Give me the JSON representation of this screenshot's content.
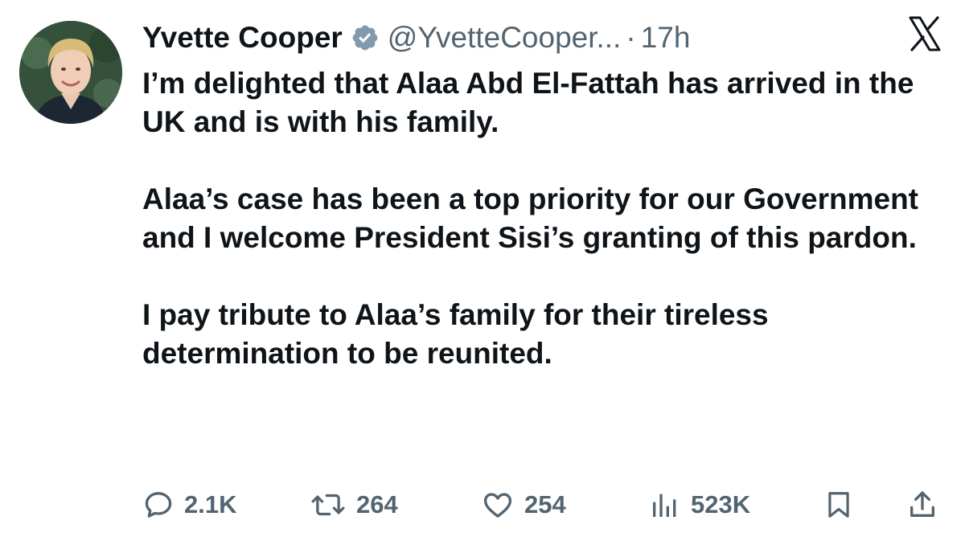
{
  "author": {
    "display_name": "Yvette Cooper",
    "handle": "@YvetteCooper...",
    "separator": "·",
    "timestamp": "17h",
    "verified_color": "#829aab"
  },
  "tweet": {
    "paragraphs": [
      "I’m delighted that Alaa Abd El-Fattah has arrived in the UK and is with his family.",
      "Alaa’s case has been a top priority for our Government and I welcome President Sisi’s granting of this pardon.",
      "I pay tribute to Alaa’s family for their tireless determination to be reunited."
    ]
  },
  "actions": {
    "replies": "2.1K",
    "reposts": "264",
    "likes": "254",
    "views": "523K"
  },
  "icons": {
    "platform_logo": "x-logo-icon",
    "reply": "comment-bubble-icon",
    "repost": "repost-arrows-icon",
    "like": "heart-icon",
    "views": "bar-chart-icon",
    "bookmark": "bookmark-icon",
    "share": "share-upload-icon"
  },
  "colors": {
    "text_primary": "#0f1419",
    "text_secondary": "#536471"
  }
}
